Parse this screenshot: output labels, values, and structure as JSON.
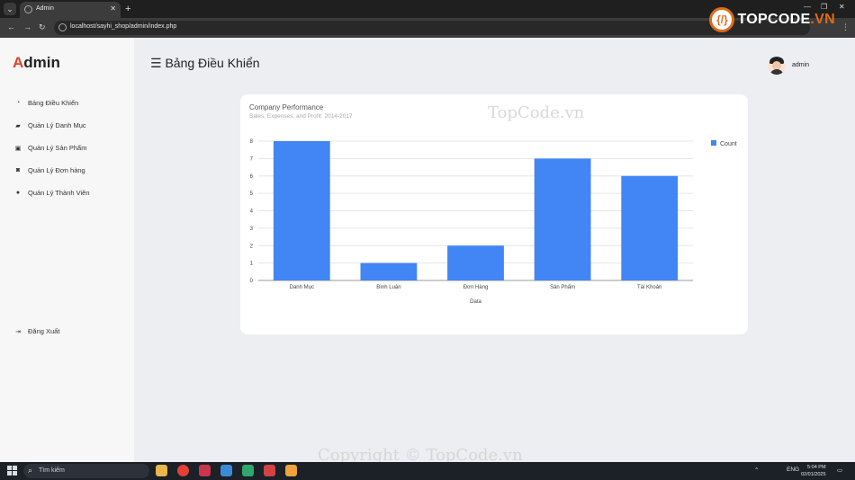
{
  "browser": {
    "tab_title": "Admin",
    "url": "localhost/sayhi_shop/admin/index.php",
    "new_tab": "+",
    "close": "✕"
  },
  "watermark": {
    "logo_text": "TOPCODE",
    "logo_suffix": ".VN",
    "center_text": "TopCode.vn",
    "copyright": "Copyright © TopCode.vn"
  },
  "sidebar": {
    "brand_first": "A",
    "brand_rest": "dmin",
    "items": [
      {
        "label": "Bảng Điều Khiển",
        "icon": "tachometer-icon"
      },
      {
        "label": "Quản Lý Danh Mục",
        "icon": "folder-open-icon"
      },
      {
        "label": "Quản Lý Sản Phẩm",
        "icon": "folder-plus-icon"
      },
      {
        "label": "Quản Lý Đơn hàng",
        "icon": "shopping-bag-icon"
      },
      {
        "label": "Quản Lý Thành Viên",
        "icon": "user-icon"
      }
    ],
    "logout": {
      "label": "Đăng Xuất",
      "icon": "sign-out-icon"
    }
  },
  "header": {
    "menu_icon": "☰",
    "title": "Bảng Điều Khiển",
    "username": "admin"
  },
  "chart_data": {
    "type": "bar",
    "title": "Company Performance",
    "subtitle": "Sales, Expenses, and Profit: 2014-2017",
    "xlabel": "Data",
    "ylabel": "",
    "categories": [
      "Danh Mục",
      "Bình Luận",
      "Đơn Hàng",
      "Sản Phẩm",
      "Tài Khoản"
    ],
    "series": [
      {
        "name": "Count",
        "values": [
          8,
          1,
          2,
          7,
          6
        ],
        "color": "#4285f4"
      }
    ],
    "ylim": [
      0,
      8
    ],
    "yticks": [
      0,
      1,
      2,
      3,
      4,
      5,
      6,
      7,
      8
    ],
    "grid": true,
    "legend": "right"
  },
  "taskbar": {
    "search_placeholder": "Tìm kiếm",
    "lang": "ENG",
    "time": "5:04 PM",
    "date": "02/01/2025"
  }
}
